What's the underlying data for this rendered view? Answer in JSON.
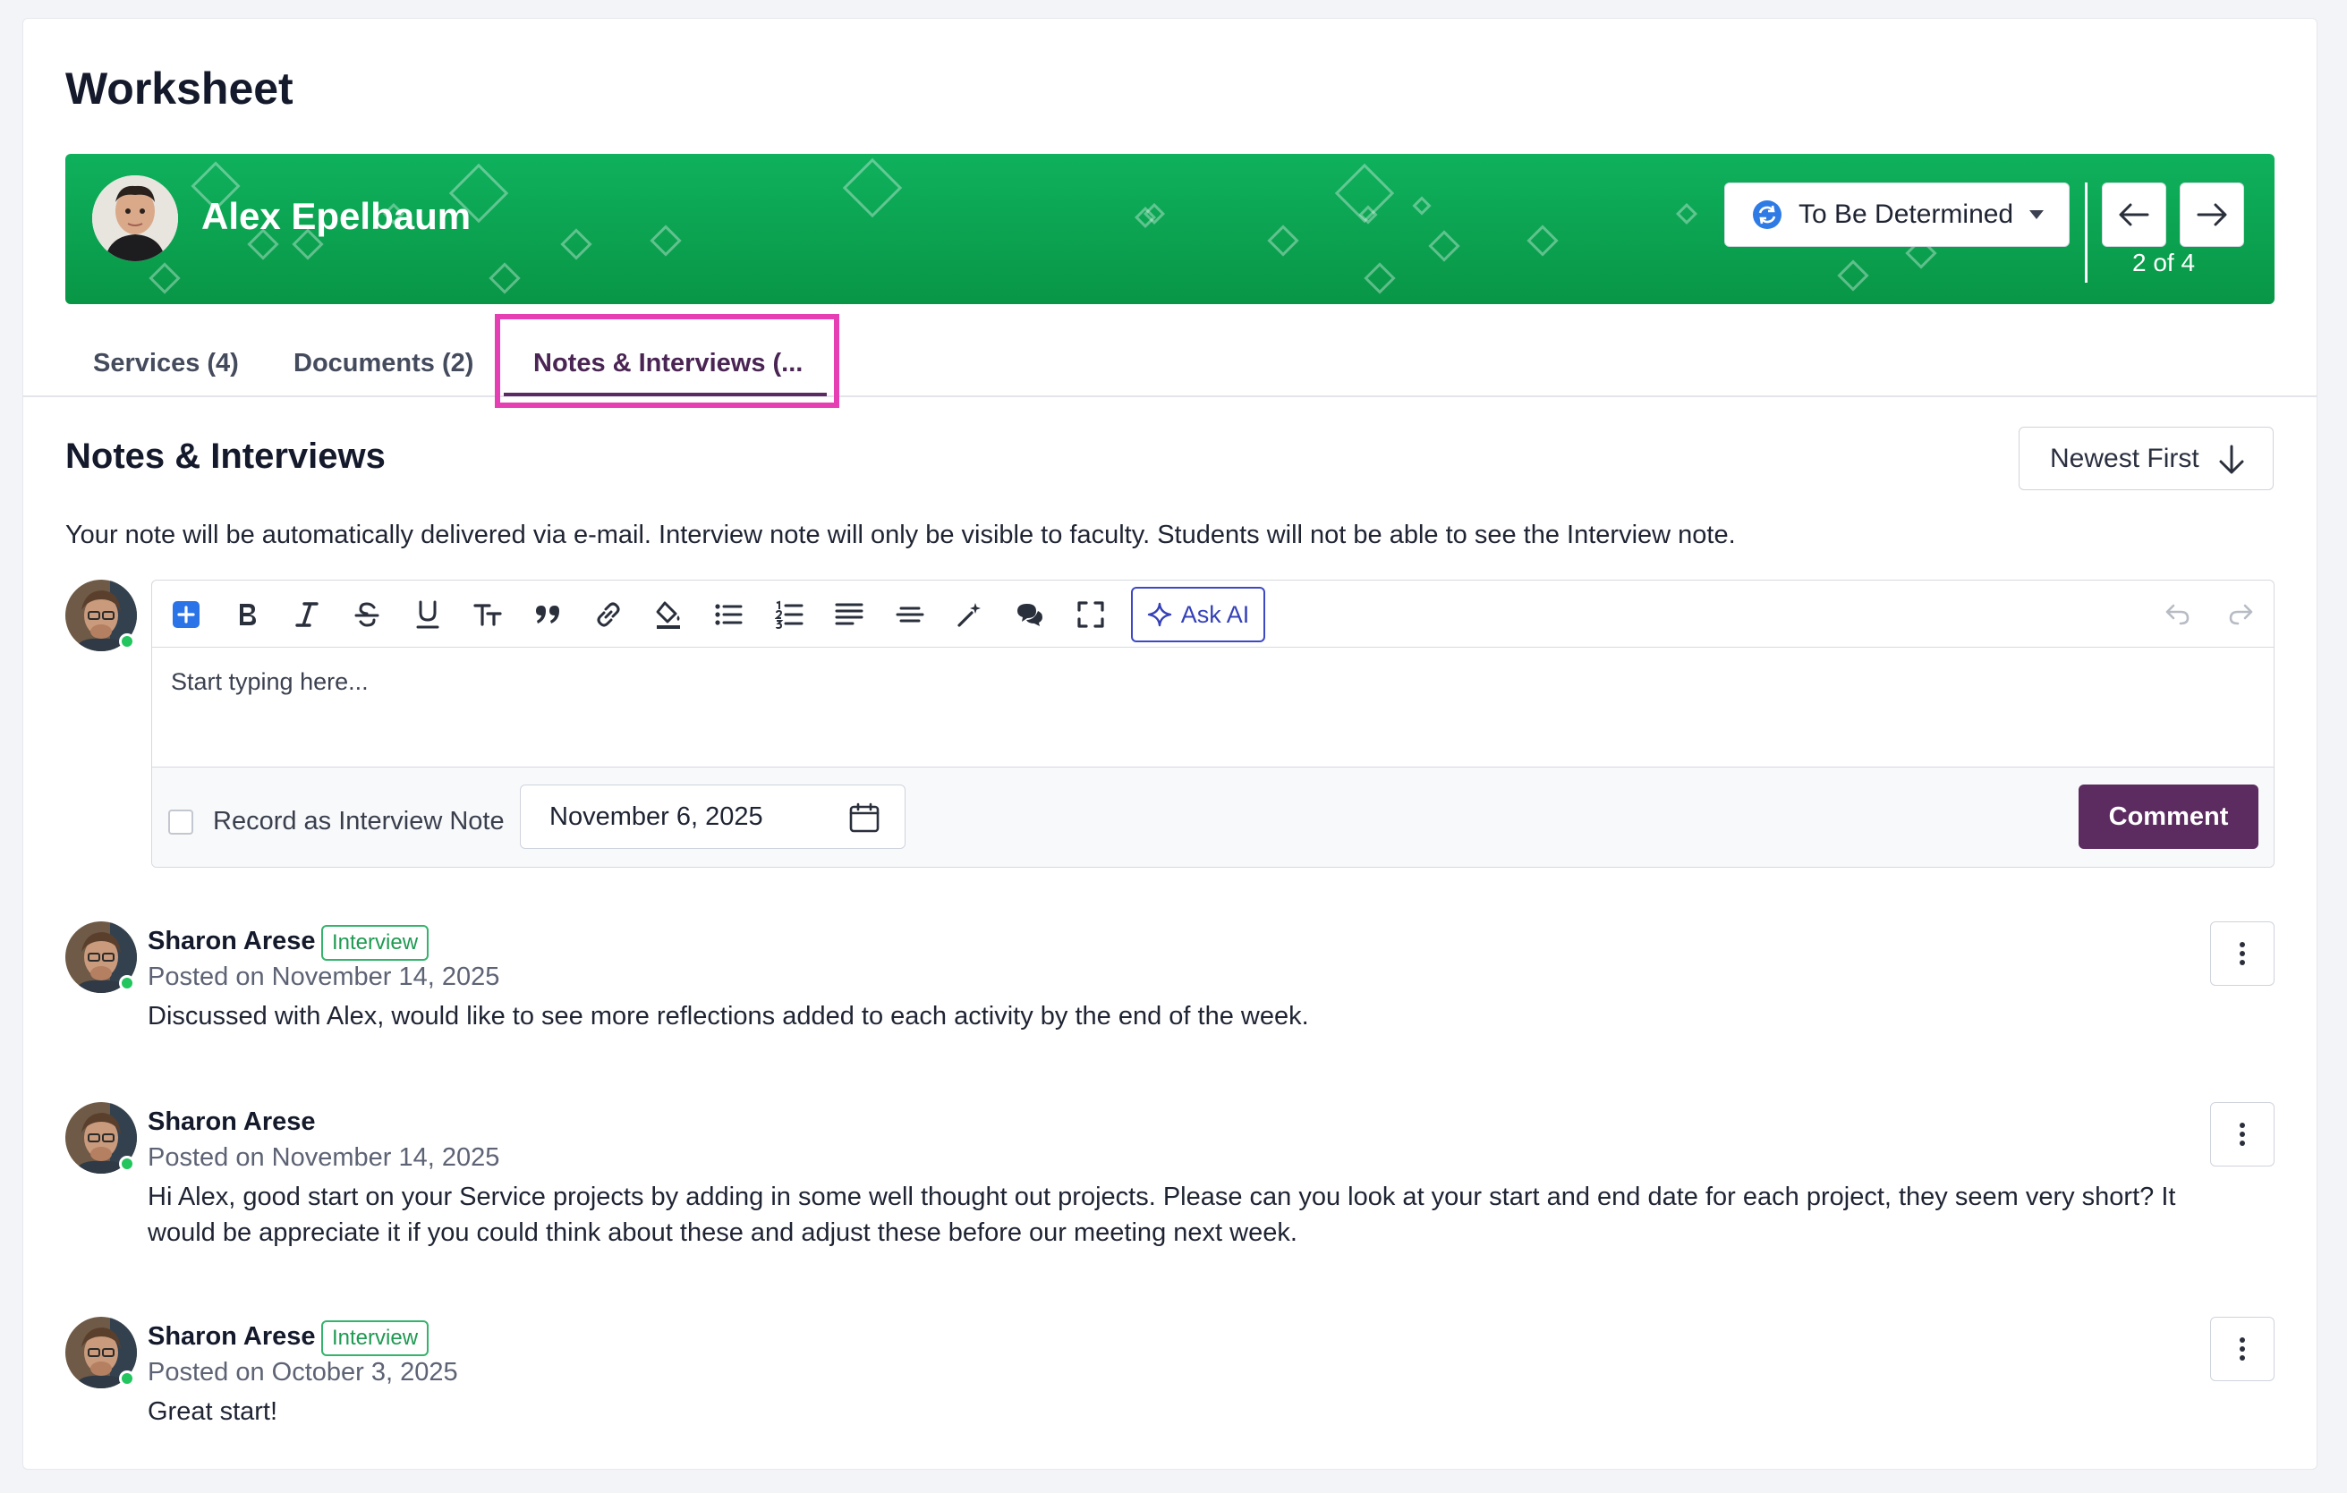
{
  "page": {
    "title": "Worksheet"
  },
  "student": {
    "name": "Alex Epelbaum",
    "status": "To Be Determined",
    "pager": "2 of 4"
  },
  "tabs": [
    {
      "label": "Services (4)"
    },
    {
      "label": "Documents (2)"
    },
    {
      "label": "Notes & Interviews (...",
      "active": true
    }
  ],
  "notes": {
    "title": "Notes & Interviews",
    "sort_label": "Newest First",
    "info": "Your note will be automatically delivered via e-mail. Interview note will only be visible to faculty. Students will not be able to see the Interview note.",
    "editor": {
      "placeholder": "Start typing here...",
      "ask_ai_label": "Ask AI",
      "record_label": "Record as Interview Note",
      "record_checked": false,
      "date_value": "November 6, 2025",
      "comment_label": "Comment"
    },
    "comments": [
      {
        "author": "Sharon Arese",
        "badge": "Interview",
        "date": "Posted on November 14, 2025",
        "body": "Discussed with Alex, would like to see more reflections added to each activity by the end of the week."
      },
      {
        "author": "Sharon Arese",
        "badge": "",
        "date": "Posted on November 14, 2025",
        "body": "Hi Alex, good start on your Service projects by adding in some well thought out projects. Please can you look at your start and end date for each project, they seem very short? It would be appreciate it if you could think about these and adjust these before our meeting next week."
      },
      {
        "author": "Sharon Arese",
        "badge": "Interview",
        "date": "Posted on October 3, 2025",
        "body": "Great start!"
      }
    ]
  },
  "colors": {
    "banner_green": "#0fa957",
    "accent_purple": "#5c2c60",
    "highlight_pink": "#e63eb3",
    "interview_badge": "#33b36b",
    "ask_ai_blue": "#3d49c4"
  }
}
